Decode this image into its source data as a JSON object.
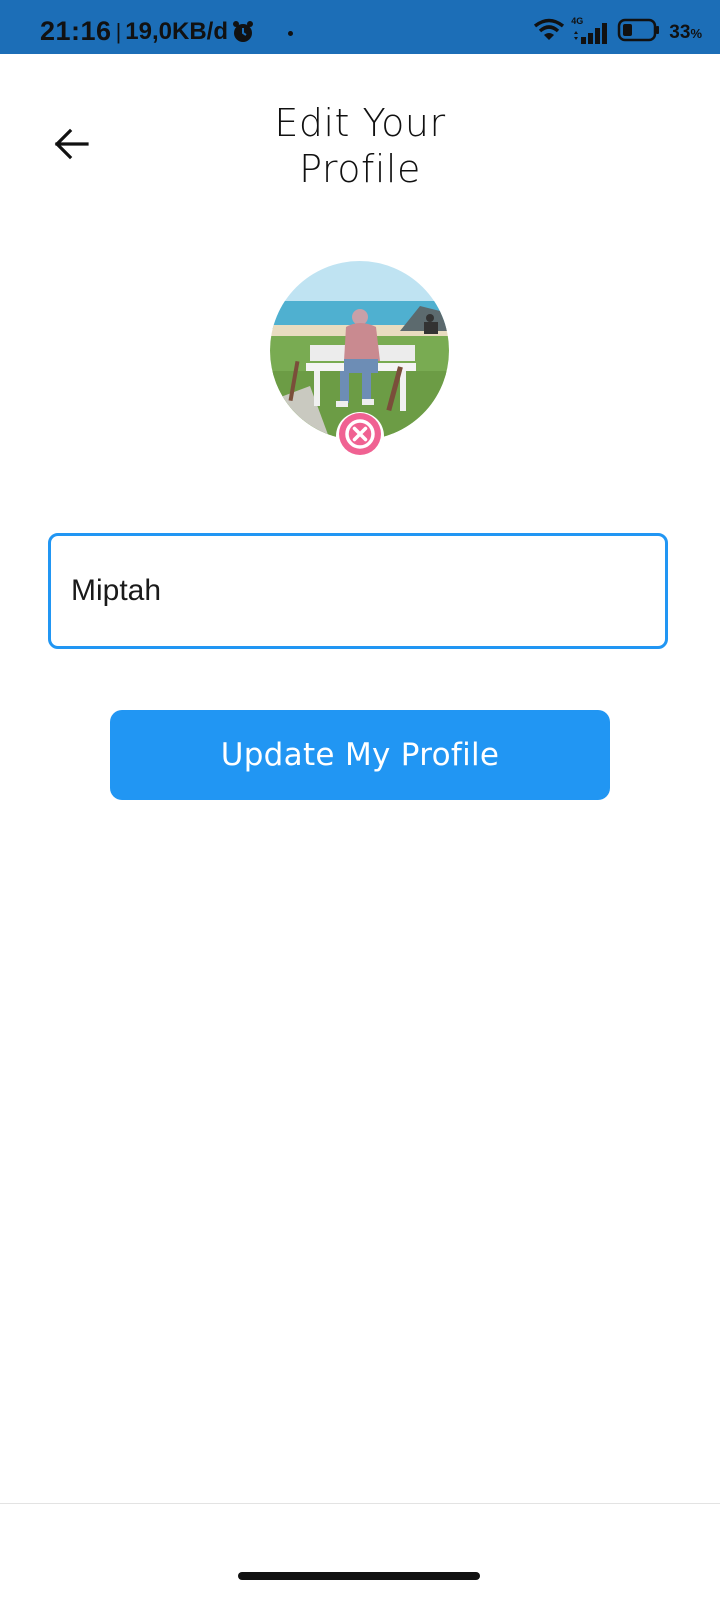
{
  "status_bar": {
    "time": "21:16",
    "separator": "|",
    "net_speed": "19,0KB/d",
    "network_type": "4G",
    "battery_percent": "33",
    "battery_unit": "%",
    "battery_level": 0.33,
    "icons": [
      "alarm-icon",
      "wifi-icon",
      "signal-icon",
      "battery-icon"
    ]
  },
  "header": {
    "title_line1": "Edit Your",
    "title_line2": "Profile",
    "back_icon": "arrow-left-icon"
  },
  "profile": {
    "avatar_image": "profile photo: person in hijab sitting on white bench by the sea",
    "remove_icon": "close-circle-icon"
  },
  "form": {
    "name_value": "Miptah",
    "name_placeholder": ""
  },
  "actions": {
    "update_label": "Update My Profile"
  },
  "colors": {
    "status_bar": "#1c6eb7",
    "primary": "#2196f3",
    "remove_badge": "#f06292"
  }
}
